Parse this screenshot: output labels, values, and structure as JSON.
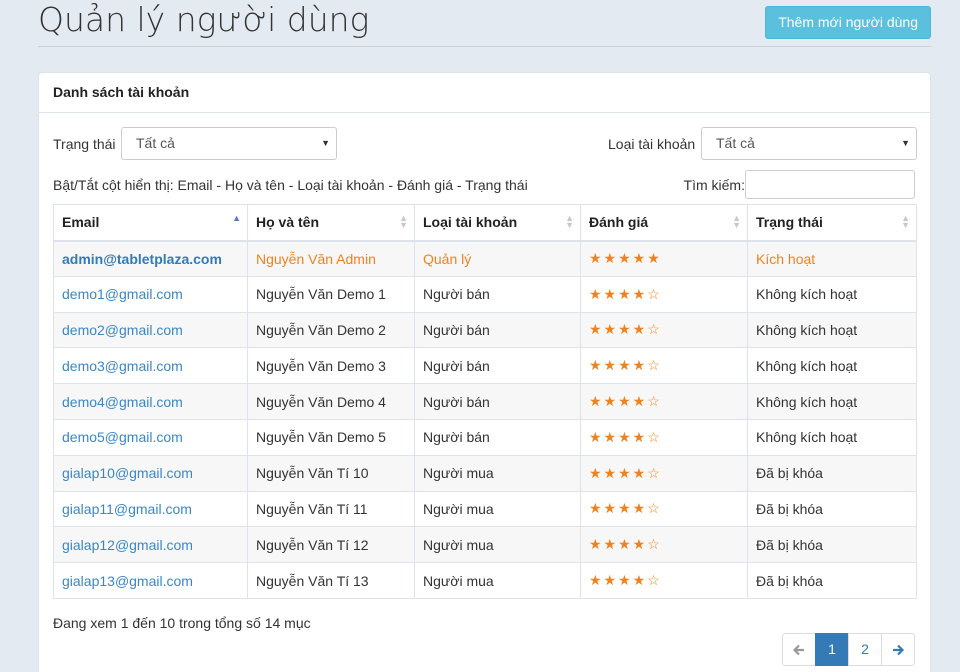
{
  "header": {
    "title": "Quản lý người dùng",
    "add_button": "Thêm mới người dùng"
  },
  "panel": {
    "title": "Danh sách tài khoản",
    "status_filter": {
      "label": "Trạng thái",
      "selected": "Tất cả"
    },
    "type_filter": {
      "label": "Loại tài khoản",
      "selected": "Tất cả"
    },
    "toggle_columns": "Bật/Tắt cột hiển thị: Email - Họ và tên - Loại tài khoản - Đánh giá - Trạng thái",
    "search_label": "Tìm kiếm:",
    "search_value": ""
  },
  "table": {
    "headers": [
      "Email",
      "Họ và tên",
      "Loại tài khoản",
      "Đánh giá",
      "Trạng thái"
    ],
    "sorted_column": "Email",
    "rows": [
      {
        "email": "admin@tabletplaza.com",
        "name": "Nguyễn Văn Admin",
        "type": "Quản lý",
        "rating": 5,
        "status": "Kích hoạt"
      },
      {
        "email": "demo1@gmail.com",
        "name": "Nguyễn Văn Demo 1",
        "type": "Người bán",
        "rating": 4,
        "status": "Không kích hoạt"
      },
      {
        "email": "demo2@gmail.com",
        "name": "Nguyễn Văn Demo 2",
        "type": "Người bán",
        "rating": 4,
        "status": "Không kích hoạt"
      },
      {
        "email": "demo3@gmail.com",
        "name": "Nguyễn Văn Demo 3",
        "type": "Người bán",
        "rating": 4,
        "status": "Không kích hoạt"
      },
      {
        "email": "demo4@gmail.com",
        "name": "Nguyễn Văn Demo 4",
        "type": "Người bán",
        "rating": 4,
        "status": "Không kích hoạt"
      },
      {
        "email": "demo5@gmail.com",
        "name": "Nguyễn Văn Demo 5",
        "type": "Người bán",
        "rating": 4,
        "status": "Không kích hoạt"
      },
      {
        "email": "gialap10@gmail.com",
        "name": "Nguyễn Văn Tí 10",
        "type": "Người mua",
        "rating": 4,
        "status": "Đã bị khóa"
      },
      {
        "email": "gialap11@gmail.com",
        "name": "Nguyễn Văn Tí 11",
        "type": "Người mua",
        "rating": 4,
        "status": "Đã bị khóa"
      },
      {
        "email": "gialap12@gmail.com",
        "name": "Nguyễn Văn Tí 12",
        "type": "Người mua",
        "rating": 4,
        "status": "Đã bị khóa"
      },
      {
        "email": "gialap13@gmail.com",
        "name": "Nguyễn Văn Tí 13",
        "type": "Người mua",
        "rating": 4,
        "status": "Đã bị khóa"
      }
    ]
  },
  "footer": {
    "info": "Đang xem 1 đến 10 trong tổng số 14 mục",
    "pages": [
      "1",
      "2"
    ],
    "current_page": "1"
  },
  "icons": {
    "prev": "arrow-left-icon",
    "next": "arrow-right-icon",
    "star_full": "star-icon",
    "star_empty": "star-outline-icon",
    "sort_asc": "sort-asc-icon",
    "sort_both": "sort-icon"
  },
  "colors": {
    "accent": "#337ab7",
    "info_button": "#5bc0de",
    "highlight": "#f0821e",
    "background": "#e4eaf1"
  }
}
